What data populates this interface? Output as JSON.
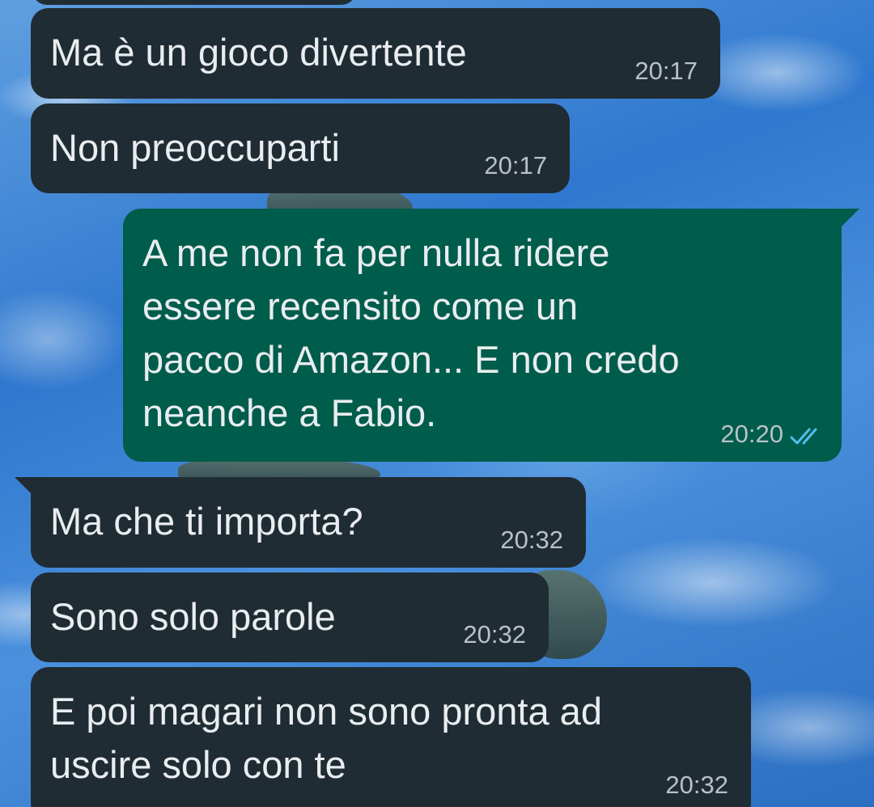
{
  "chat": {
    "messages": [
      {
        "text": "Ma è un gioco divertente",
        "time": "20:17",
        "direction": "incoming"
      },
      {
        "text": "Non preoccuparti",
        "time": "20:17",
        "direction": "incoming"
      },
      {
        "text": "A me non fa per nulla ridere\nessere recensito come un\npacco di Amazon... E non credo\nneanche a Fabio.",
        "time": "20:20",
        "direction": "outgoing",
        "status_icon": "read-double-check-icon"
      },
      {
        "text": "Ma che ti importa?",
        "time": "20:32",
        "direction": "incoming"
      },
      {
        "text": "Sono solo parole",
        "time": "20:32",
        "direction": "incoming"
      },
      {
        "text": "E poi magari non sono pronta ad\nuscire solo con te",
        "time": "20:32",
        "direction": "incoming"
      }
    ]
  },
  "colors": {
    "incoming_bubble": "#202c33",
    "outgoing_bubble": "#005c4b",
    "text": "#e9edef",
    "timestamp": "#b8c2c6",
    "read_ticks": "#53bdeb"
  }
}
